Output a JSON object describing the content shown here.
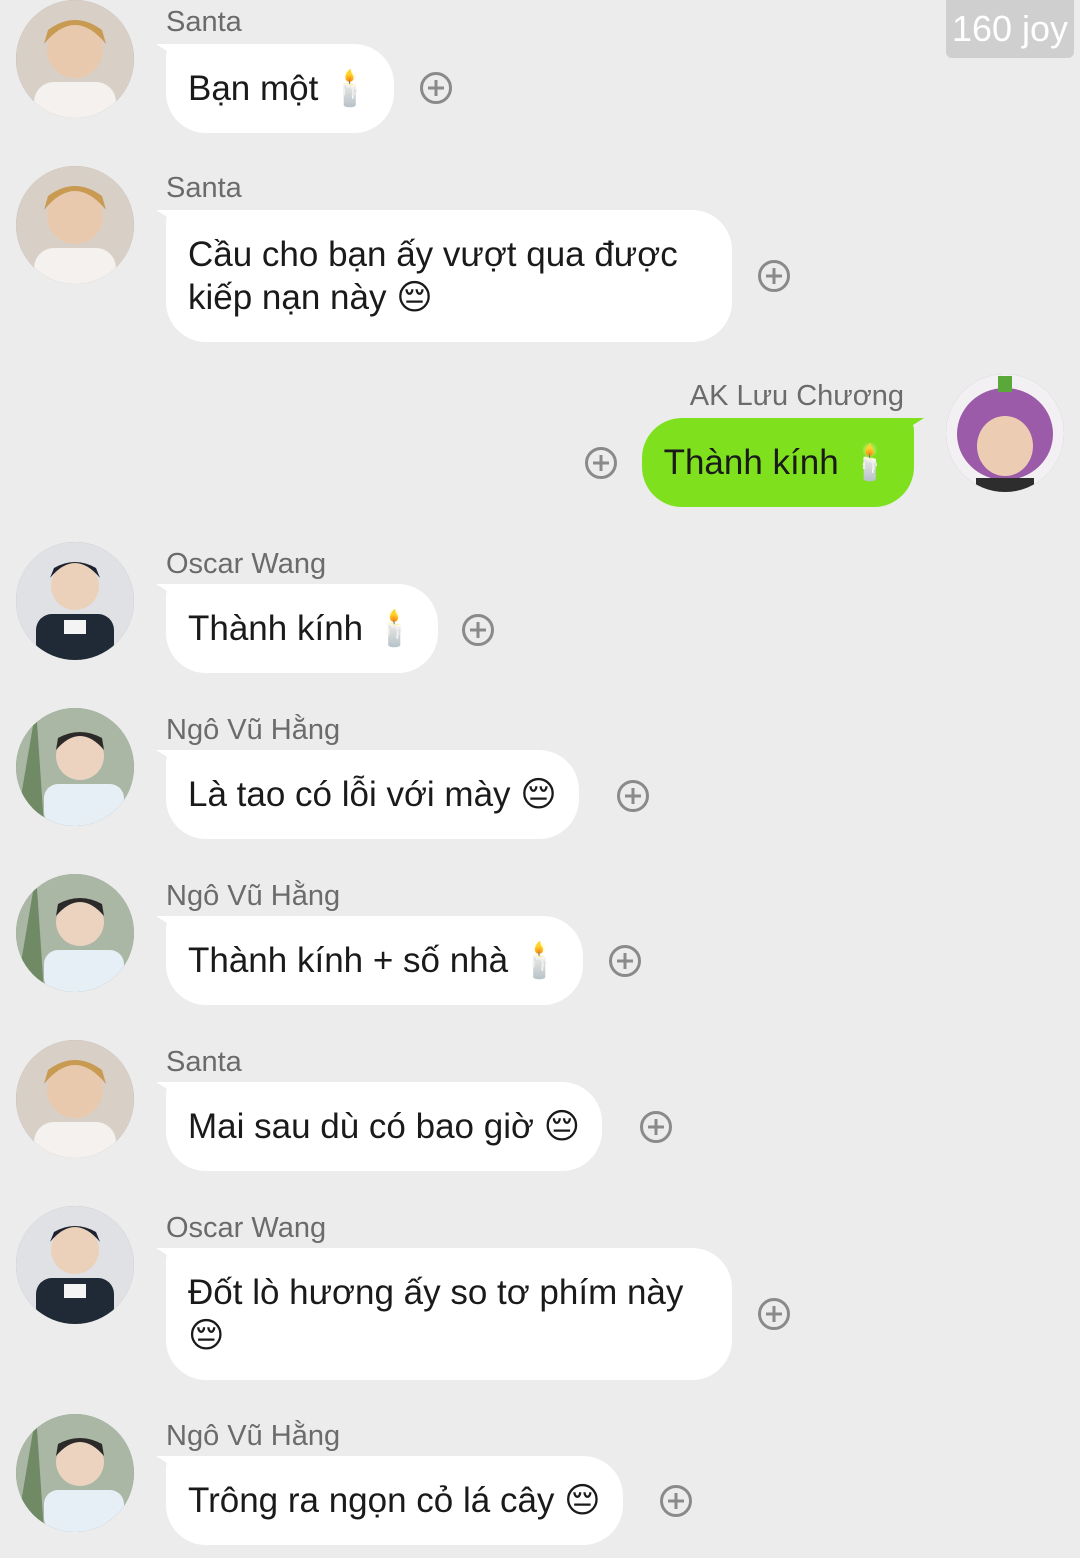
{
  "badge": "160 joy",
  "colors": {
    "background": "#ececec",
    "bubble_incoming": "#ffffff",
    "bubble_outgoing": "#7fe01e",
    "sender_text": "#6b6b6b"
  },
  "messages": [
    {
      "sender": "Santa",
      "text": "Bạn một 🕯️",
      "side": "left",
      "avatar": "santa"
    },
    {
      "sender": "Santa",
      "text": "Cầu cho bạn ấy vượt qua được kiếp nạn này 😔",
      "side": "left",
      "avatar": "santa"
    },
    {
      "sender": "AK Lưu Chương",
      "text": "Thành kính 🕯️",
      "side": "right",
      "avatar": "ak"
    },
    {
      "sender": "Oscar Wang",
      "text": "Thành kính 🕯️",
      "side": "left",
      "avatar": "oscar"
    },
    {
      "sender": "Ngô Vũ Hằng",
      "text": "Là tao có lỗi với mày 😔",
      "side": "left",
      "avatar": "ngo"
    },
    {
      "sender": "Ngô Vũ Hằng",
      "text": "Thành kính + số nhà 🕯️",
      "side": "left",
      "avatar": "ngo"
    },
    {
      "sender": "Santa",
      "text": "Mai sau dù có bao giờ 😔",
      "side": "left",
      "avatar": "santa"
    },
    {
      "sender": "Oscar Wang",
      "text": "Đốt lò hương ấy so tơ phím này 😔",
      "side": "left",
      "avatar": "oscar"
    },
    {
      "sender": "Ngô Vũ Hằng",
      "text": "Trông ra ngọn cỏ lá cây 😔",
      "side": "left",
      "avatar": "ngo"
    }
  ]
}
